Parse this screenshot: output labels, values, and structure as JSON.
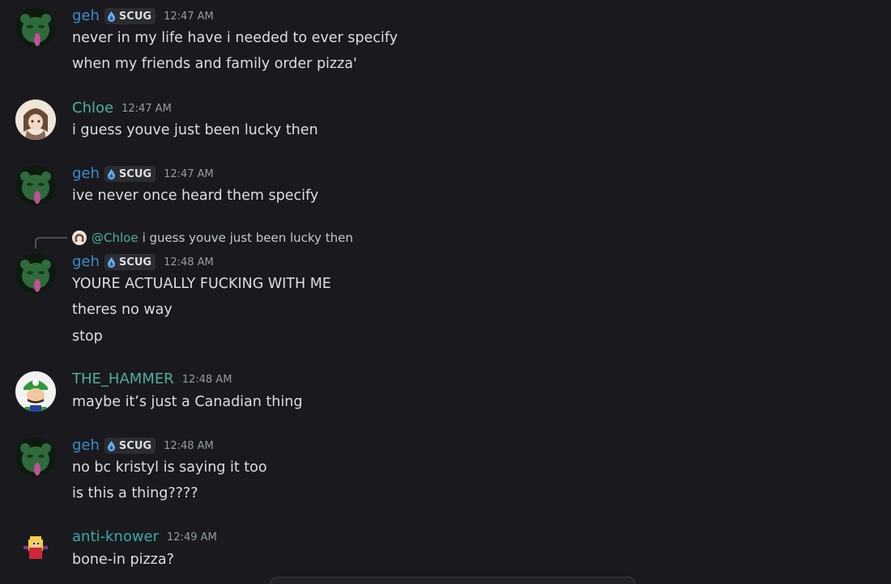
{
  "colors": {
    "background": "#1a1a1e",
    "text": "#dbdee1",
    "timestamp": "#949ba4",
    "geh": "#3d8bc9",
    "chloe": "#4fae9e",
    "hammer": "#4fae9e",
    "antiknower": "#3aa8a8"
  },
  "messages": [
    {
      "author": "geh",
      "tag": "SCUG",
      "time": "12:47 AM",
      "avatar_icon": "green-creature-avatar",
      "lines": [
        "never in my life have i needed to ever specify",
        "when my friends and family order pizza'"
      ]
    },
    {
      "author": "Chloe",
      "time": "12:47 AM",
      "avatar_icon": "anime-character-avatar",
      "lines": [
        "i guess youve just been lucky then"
      ]
    },
    {
      "author": "geh",
      "tag": "SCUG",
      "time": "12:47 AM",
      "avatar_icon": "green-creature-avatar",
      "lines": [
        "ive never once heard them specify"
      ]
    },
    {
      "reply": {
        "mention": "@Chloe",
        "text": "i guess youve just been lucky then"
      },
      "author": "geh",
      "tag": "SCUG",
      "time": "12:48 AM",
      "avatar_icon": "green-creature-avatar",
      "lines": [
        "YOURE ACTUALLY FUCKING WITH ME",
        "theres no way",
        "stop"
      ]
    },
    {
      "author": "THE_HAMMER",
      "time": "12:48 AM",
      "avatar_icon": "luigi-avatar",
      "lines": [
        "maybe it’s just a Canadian thing"
      ]
    },
    {
      "author": "geh",
      "tag": "SCUG",
      "time": "12:48 AM",
      "avatar_icon": "green-creature-avatar",
      "lines": [
        "no bc kristyl is saying it too",
        "is this a thing????"
      ]
    },
    {
      "author": "anti-knower",
      "time": "12:49 AM",
      "avatar_icon": "pixel-character-avatar",
      "lines": [
        "bone-in pizza?"
      ]
    }
  ]
}
